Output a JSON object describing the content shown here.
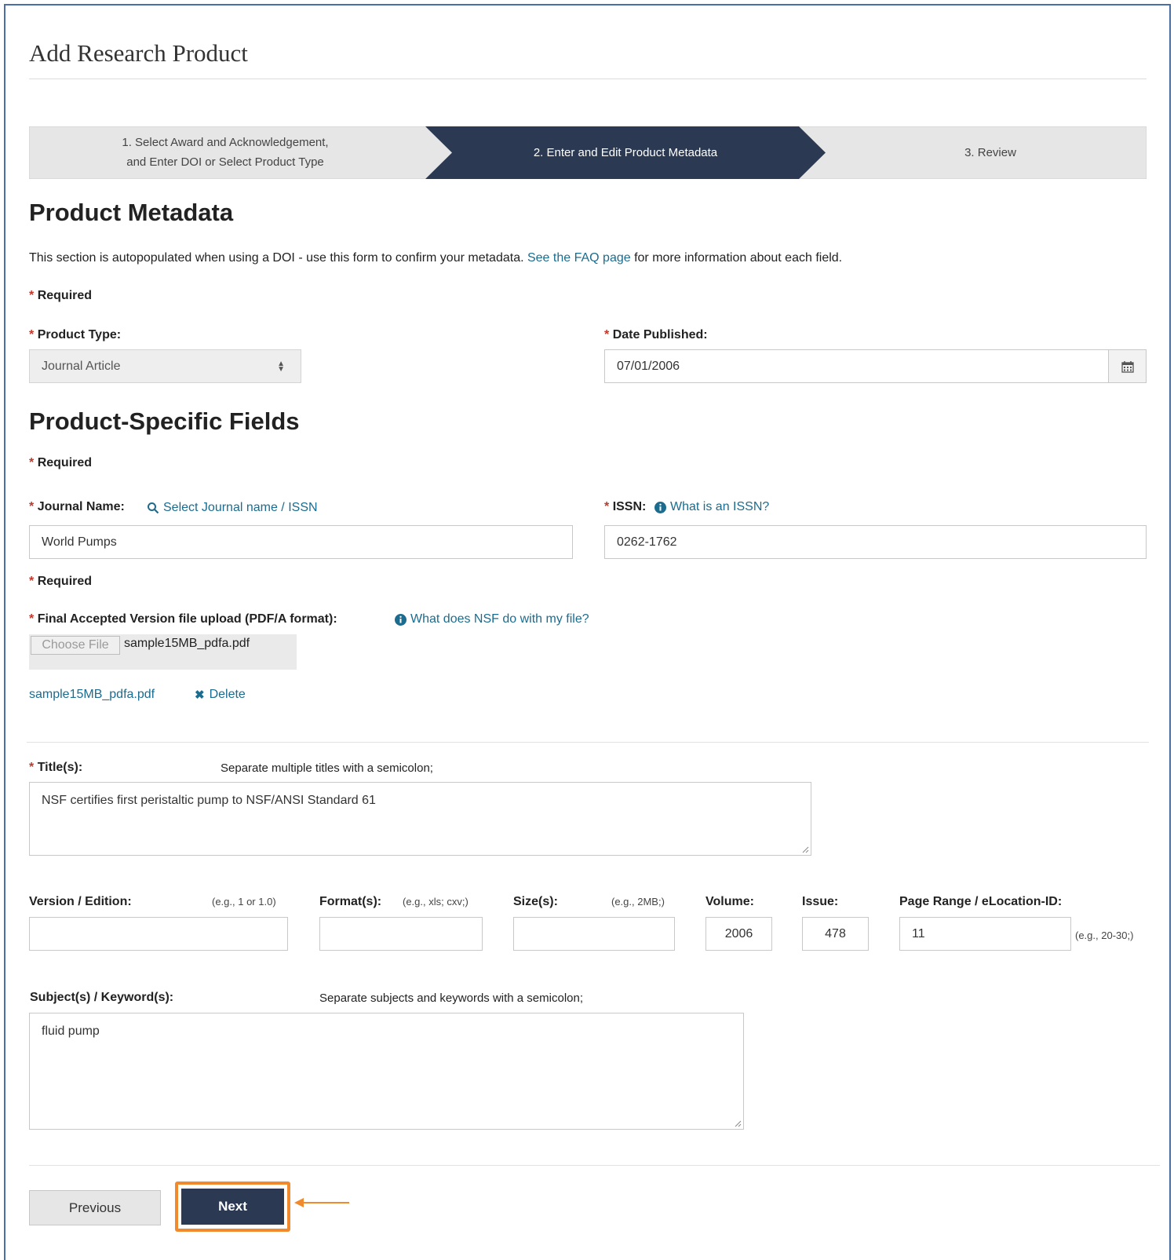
{
  "page_title": "Add Research Product",
  "steps": [
    {
      "line1": "1. Select Award and Acknowledgement,",
      "line2": "and Enter DOI or Select Product Type"
    },
    {
      "label": "2. Enter and Edit Product Metadata"
    },
    {
      "label": "3. Review"
    }
  ],
  "product_metadata": {
    "heading": "Product Metadata",
    "intro_before": "This section is autopopulated when using a DOI - use this form to confirm your metadata. ",
    "faq_link": "See the FAQ page",
    "intro_after": " for more information about each field.",
    "required": "Required",
    "product_type_label": "Product Type:",
    "product_type_value": "Journal Article",
    "date_label": "Date Published:",
    "date_value": "07/01/2006"
  },
  "product_specific": {
    "heading": "Product-Specific Fields",
    "required": "Required",
    "journal_label": "Journal Name:",
    "journal_select_link": "Select Journal name / ISSN",
    "journal_value": "World Pumps",
    "issn_label": "ISSN:",
    "issn_help_link": "What is an ISSN?",
    "issn_value": "0262-1762",
    "required2": "Required",
    "upload_label": "Final Accepted Version file upload (PDF/A format):",
    "upload_help_link": "What does NSF do with my file?",
    "choose_file_label": "Choose File",
    "chosen_file_name": "sample15MB_pdfa.pdf",
    "uploaded_file_link": "sample15MB_pdfa.pdf",
    "delete_label": "Delete",
    "title_label": "Title(s):",
    "title_hint": "Separate multiple titles with a semicolon;",
    "title_value": "NSF certifies first peristaltic pump to NSF/ANSI Standard 61",
    "version_label": "Version / Edition:",
    "version_hint": "(e.g., 1 or 1.0)",
    "version_value": "",
    "format_label": "Format(s):",
    "format_hint": "(e.g., xls; cxv;)",
    "format_value": "",
    "size_label": "Size(s):",
    "size_hint": "(e.g., 2MB;)",
    "size_value": "",
    "volume_label": "Volume:",
    "volume_value": "2006",
    "issue_label": "Issue:",
    "issue_value": "478",
    "page_range_label": "Page Range / eLocation-ID:",
    "page_range_value": "11",
    "page_range_hint": "(e.g., 20-30;)",
    "subjects_label": "Subject(s) / Keyword(s):",
    "subjects_hint": "Separate subjects and keywords with a semicolon;",
    "subjects_value": "fluid pump"
  },
  "buttons": {
    "previous": "Previous",
    "next": "Next"
  },
  "colors": {
    "active_step": "#2b3a52",
    "inactive_step": "#e6e6e6",
    "link": "#1b6c8f",
    "required_star": "#c0392b",
    "highlight": "#f08a2c"
  }
}
